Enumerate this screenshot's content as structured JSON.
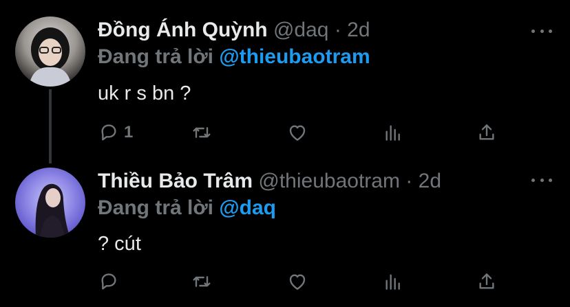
{
  "tweets": [
    {
      "name": "Đồng Ánh Quỳnh",
      "handle": "@daq",
      "separator": "·",
      "time": "2d",
      "replying_label": "Đang trả lời",
      "replying_to": "@thieubaotram",
      "text": "uk r s bn ?",
      "reply_count": "1"
    },
    {
      "name": "Thiều Bảo Trâm",
      "handle": "@thieubaotram",
      "separator": "·",
      "time": "2d",
      "replying_label": "Đang trả lời",
      "replying_to": "@daq",
      "text": "? cút",
      "reply_count": ""
    }
  ],
  "colors": {
    "background": "#000000",
    "text": "#e7e9ea",
    "muted": "#71767b",
    "accent": "#1d9bf0"
  },
  "icons": [
    "reply-icon",
    "retweet-icon",
    "like-icon",
    "views-icon",
    "share-icon",
    "more-icon"
  ]
}
